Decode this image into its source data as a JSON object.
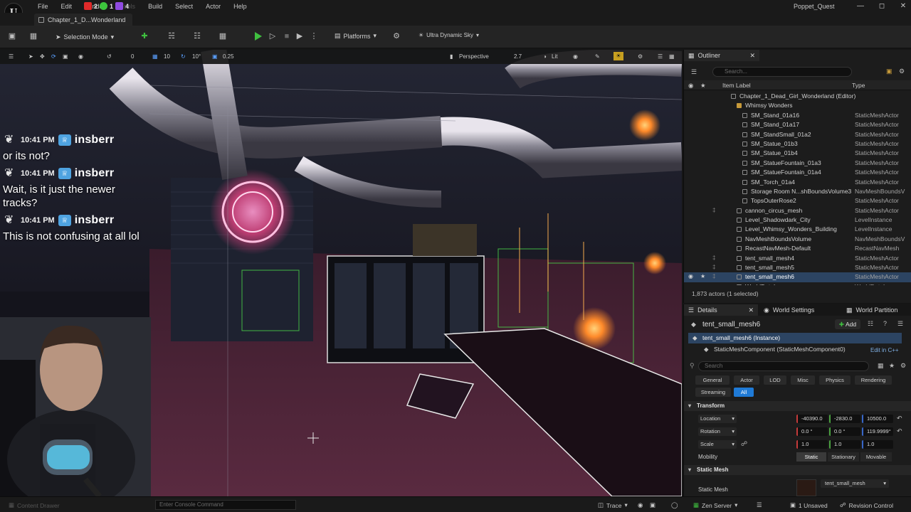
{
  "menubar": {
    "items": [
      "File",
      "Edit",
      "Window",
      "Tools",
      "Build",
      "Select",
      "Actor",
      "Help"
    ],
    "stream_counts": [
      "2",
      "1",
      "4"
    ],
    "app_title": "Poppet_Quest",
    "logo": "U"
  },
  "tabs": {
    "level_tab": "Chapter_1_D...Wonderland"
  },
  "toolbar": {
    "selection_mode": "Selection Mode",
    "platforms": "Platforms",
    "sky": "Ultra Dynamic Sky"
  },
  "viewport_toolbar": {
    "rotation_snap": "0",
    "grid_snap": "10",
    "angle_snap": "10°",
    "scale_snap": "0.25",
    "perspective": "Perspective",
    "speed": "2.7",
    "lit": "Lit"
  },
  "chat": [
    {
      "time": "10:41 PM",
      "user": "insberr",
      "message": "or its not?"
    },
    {
      "time": "10:41 PM",
      "user": "insberr",
      "message": "Wait, is it just the newer tracks?"
    },
    {
      "time": "10:41 PM",
      "user": "insberr",
      "message": "This is not confusing at all lol"
    }
  ],
  "outliner": {
    "tab": "Outliner",
    "search_placeholder": "Search...",
    "col_label": "Item Label",
    "col_type": "Type",
    "rows": [
      {
        "label": "Chapter_1_Dead_Girl_Wonderland (Editor)",
        "type": "",
        "indent": 78,
        "kind": "level"
      },
      {
        "label": "Whimsy Wonders",
        "type": "",
        "indent": 86,
        "kind": "folder"
      },
      {
        "label": "SM_Stand_01a16",
        "type": "StaticMeshActor",
        "indent": 94,
        "kind": "mesh"
      },
      {
        "label": "SM_Stand_01a17",
        "type": "StaticMeshActor",
        "indent": 94,
        "kind": "mesh"
      },
      {
        "label": "SM_StandSmall_01a2",
        "type": "StaticMeshActor",
        "indent": 94,
        "kind": "mesh"
      },
      {
        "label": "SM_Statue_01b3",
        "type": "StaticMeshActor",
        "indent": 94,
        "kind": "mesh"
      },
      {
        "label": "SM_Statue_01b4",
        "type": "StaticMeshActor",
        "indent": 94,
        "kind": "mesh"
      },
      {
        "label": "SM_StatueFountain_01a3",
        "type": "StaticMeshActor",
        "indent": 94,
        "kind": "mesh"
      },
      {
        "label": "SM_StatueFountain_01a4",
        "type": "StaticMeshActor",
        "indent": 94,
        "kind": "mesh"
      },
      {
        "label": "SM_Torch_01a4",
        "type": "StaticMeshActor",
        "indent": 94,
        "kind": "mesh"
      },
      {
        "label": "Storage Room N...shBoundsVolume3",
        "type": "NavMeshBoundsV",
        "indent": 94,
        "kind": "mesh"
      },
      {
        "label": "TopsOuterRose2",
        "type": "StaticMeshActor",
        "indent": 94,
        "kind": "mesh"
      },
      {
        "label": "cannon_circus_mesh",
        "type": "StaticMeshActor",
        "indent": 86,
        "kind": "mesh",
        "pin": true
      },
      {
        "label": "Level_Shadowdark_City",
        "type": "LevelInstance",
        "indent": 86,
        "kind": "mesh"
      },
      {
        "label": "Level_Whimsy_Wonders_Building",
        "type": "LevelInstance",
        "indent": 86,
        "kind": "mesh"
      },
      {
        "label": "NavMeshBoundsVolume",
        "type": "NavMeshBoundsV",
        "indent": 86,
        "kind": "mesh"
      },
      {
        "label": "RecastNavMesh-Default",
        "type": "RecastNavMesh",
        "indent": 86,
        "kind": "mesh"
      },
      {
        "label": "tent_small_mesh4",
        "type": "StaticMeshActor",
        "indent": 86,
        "kind": "mesh",
        "pin": true
      },
      {
        "label": "tent_small_mesh5",
        "type": "StaticMeshActor",
        "indent": 86,
        "kind": "mesh",
        "pin": true
      },
      {
        "label": "tent_small_mesh6",
        "type": "StaticMeshActor",
        "indent": 86,
        "kind": "mesh",
        "pin": true,
        "selected": true
      },
      {
        "label": "WorldDataLayers",
        "type": "WorldDataLayers",
        "indent": 86,
        "kind": "mesh"
      }
    ],
    "count": "1,873 actors (1 selected)"
  },
  "details": {
    "tabs": [
      "Details",
      "World Settings",
      "World Partition"
    ],
    "actor_name": "tent_small_mesh6",
    "add_label": "Add",
    "instance_row": "tent_small_mesh6 (Instance)",
    "component_row": "StaticMeshComponent (StaticMeshComponent0)",
    "edit_cpp": "Edit in C++",
    "search_placeholder": "Search",
    "filters": [
      "General",
      "Actor",
      "LOD",
      "Misc",
      "Physics",
      "Rendering",
      "Streaming",
      "All"
    ],
    "transform_title": "Transform",
    "location_label": "Location",
    "rotation_label": "Rotation",
    "scale_label": "Scale",
    "mobility_label": "Mobility",
    "location": [
      "-40390.0",
      "-2830.0",
      "10500.0"
    ],
    "rotation": [
      "0.0 °",
      "0.0 °",
      "119.9999°"
    ],
    "scale": [
      "1.0",
      "1.0",
      "1.0"
    ],
    "mobility": [
      "Static",
      "Stationary",
      "Movable"
    ],
    "static_mesh_title": "Static Mesh",
    "static_mesh_label": "Static Mesh",
    "static_mesh_value": "tent_small_mesh"
  },
  "statusbar": {
    "content_drawer": "Content Drawer",
    "console_placeholder": "Enter Console Command",
    "trace": "Trace",
    "zen": "Zen Server",
    "unsaved": "1 Unsaved",
    "revision": "Revision Control"
  }
}
